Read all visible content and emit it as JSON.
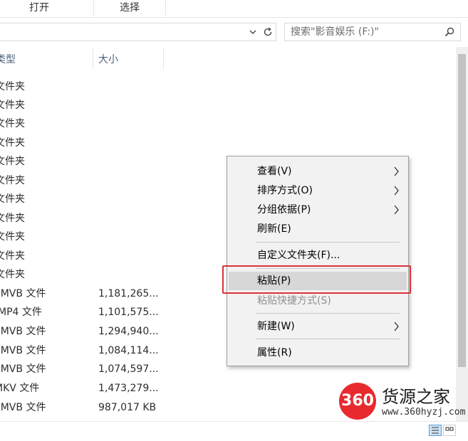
{
  "ribbon": {
    "open_label": "打开",
    "select_label": "选择"
  },
  "address": {
    "dropdown_icon": "chevron-down-icon",
    "refresh_icon": "refresh-icon"
  },
  "search": {
    "placeholder": "搜索\"影音娱乐 (F:)\"",
    "icon": "search-icon"
  },
  "columns": {
    "type": "类型",
    "size": "大小"
  },
  "files": [
    {
      "type": "文件夹",
      "size": ""
    },
    {
      "type": "文件夹",
      "size": ""
    },
    {
      "type": "文件夹",
      "size": ""
    },
    {
      "type": "文件夹",
      "size": ""
    },
    {
      "type": "文件夹",
      "size": ""
    },
    {
      "type": "文件夹",
      "size": ""
    },
    {
      "type": "文件夹",
      "size": ""
    },
    {
      "type": "文件夹",
      "size": ""
    },
    {
      "type": "文件夹",
      "size": ""
    },
    {
      "type": "文件夹",
      "size": ""
    },
    {
      "type": "文件夹",
      "size": ""
    },
    {
      "type": "RMVB 文件",
      "size": "1,181,265..."
    },
    {
      "type": "MP4 文件",
      "size": "1,101,575..."
    },
    {
      "type": "RMVB 文件",
      "size": "1,294,940..."
    },
    {
      "type": "RMVB 文件",
      "size": "1,084,114..."
    },
    {
      "type": "RMVB 文件",
      "size": "1,074,597..."
    },
    {
      "type": "MKV 文件",
      "size": "1,473,279..."
    },
    {
      "type": "RMVB 文件",
      "size": "987,017 KB"
    }
  ],
  "context_menu": {
    "items": [
      {
        "label": "查看(V)",
        "submenu": true,
        "disabled": false
      },
      {
        "label": "排序方式(O)",
        "submenu": true,
        "disabled": false
      },
      {
        "label": "分组依据(P)",
        "submenu": true,
        "disabled": false
      },
      {
        "label": "刷新(E)",
        "submenu": false,
        "disabled": false
      },
      {
        "label": "自定义文件夹(F)...",
        "submenu": false,
        "disabled": false
      },
      {
        "label": "粘贴(P)",
        "submenu": false,
        "disabled": false,
        "highlighted": true
      },
      {
        "label": "粘贴快捷方式(S)",
        "submenu": false,
        "disabled": true
      },
      {
        "label": "新建(W)",
        "submenu": true,
        "disabled": false
      },
      {
        "label": "属性(R)",
        "submenu": false,
        "disabled": false
      }
    ]
  },
  "watermark": {
    "logo_text": "360",
    "name": "货源之家",
    "url": "www.360hyzj.com"
  },
  "colors": {
    "highlight_box": "#d9323a",
    "menu_bg": "#f2f2f2",
    "menu_hover": "#d7d7d7",
    "header_text": "#4c607a",
    "disabled_text": "#8f8f8f"
  }
}
